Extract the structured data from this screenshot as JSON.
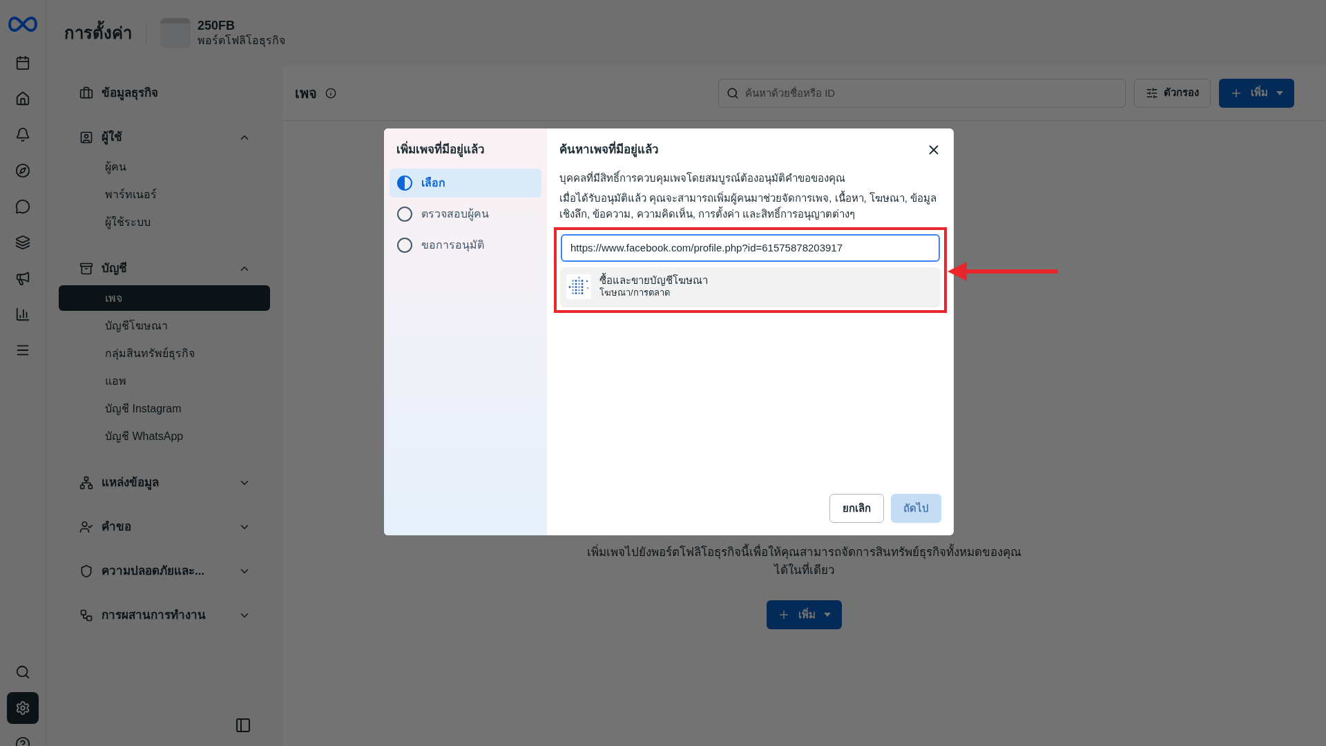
{
  "rail": {
    "items": [
      {
        "selected": false
      },
      {
        "selected": false
      },
      {
        "selected": false
      },
      {
        "selected": false
      },
      {
        "selected": false
      },
      {
        "selected": false
      },
      {
        "selected": false
      },
      {
        "selected": false
      },
      {
        "selected": false
      }
    ],
    "bottom": [
      {
        "selected": false
      },
      {
        "selected": true
      },
      {
        "selected": false
      }
    ]
  },
  "header": {
    "title": "การตั้งค่า",
    "business_name": "250FB",
    "business_type": "พอร์ตโฟลิโอธุรกิจ"
  },
  "sidebar": {
    "sections": [
      {
        "label": "ข้อมูลธุรกิจ"
      },
      {
        "label": "ผู้ใช้",
        "expanded": true,
        "children": [
          {
            "label": "ผู้คน",
            "selected": false
          },
          {
            "label": "พาร์ทเนอร์",
            "selected": false
          },
          {
            "label": "ผู้ใช้ระบบ",
            "selected": false
          }
        ]
      },
      {
        "label": "บัญชี",
        "expanded": true,
        "children": [
          {
            "label": "เพจ",
            "selected": true
          },
          {
            "label": "บัญชีโฆษณา",
            "selected": false
          },
          {
            "label": "กลุ่มสินทรัพย์ธุรกิจ",
            "selected": false
          },
          {
            "label": "แอพ",
            "selected": false
          },
          {
            "label": "บัญชี Instagram",
            "selected": false
          },
          {
            "label": "บัญชี WhatsApp",
            "selected": false
          }
        ]
      },
      {
        "label": "แหล่งข้อมูล",
        "expanded": false
      },
      {
        "label": "คำขอ",
        "expanded": false
      },
      {
        "label": "ความปลอดภัยและ...",
        "expanded": false
      },
      {
        "label": "การผสานการทำงาน",
        "expanded": false
      }
    ]
  },
  "main": {
    "title": "เพจ",
    "search": {
      "placeholder": "ค้นหาด้วยชื่อหรือ ID"
    },
    "filter_button": "ตัวกรอง",
    "add_button": "เพิ่ม",
    "empty_text": [
      "เพิ่มเพจไปยังพอร์ตโฟลิโอธุรกิจนี้เพื่อให้คุณสามารถจัดการสินทรัพย์ธุรกิจทั้งหมดของคุณ",
      "ได้ในที่เดียว"
    ],
    "empty_add_button": "เพิ่ม"
  },
  "dialog": {
    "steps_title": "เพิ่มเพจที่มีอยู่แล้ว",
    "steps": [
      {
        "label": "เลือก",
        "selected": true
      },
      {
        "label": "ตรวจสอบผู้คน",
        "selected": false
      },
      {
        "label": "ขอการอนุมัติ",
        "selected": false
      }
    ],
    "title": "ค้นหาเพจที่มีอยู่แล้ว",
    "description": [
      "บุคคลที่มีสิทธิ์การควบคุมเพจโดยสมบูรณ์ต้องอนุมัติคำขอของคุณ",
      "เมื่อได้รับอนุมัติแล้ว คุณจะสามารถเพิ่มผู้คนมาช่วยจัดการเพจ, เนื้อหา, โฆษณา, ข้อมูลเชิงลึก, ข้อความ, ความคิดเห็น, การตั้งค่า และสิทธิ์การอนุญาตต่างๆ"
    ],
    "url_value": "https://www.facebook.com/profile.php?id=61575878203917",
    "result": {
      "name": "ซื้อและขายบัญชีโฆษณา",
      "category": "โฆษณา/การตลาด"
    },
    "cancel_button": "ยกเลิก",
    "next_button": {
      "label": "ถัดไป",
      "disabled": true
    },
    "highlight": true
  }
}
